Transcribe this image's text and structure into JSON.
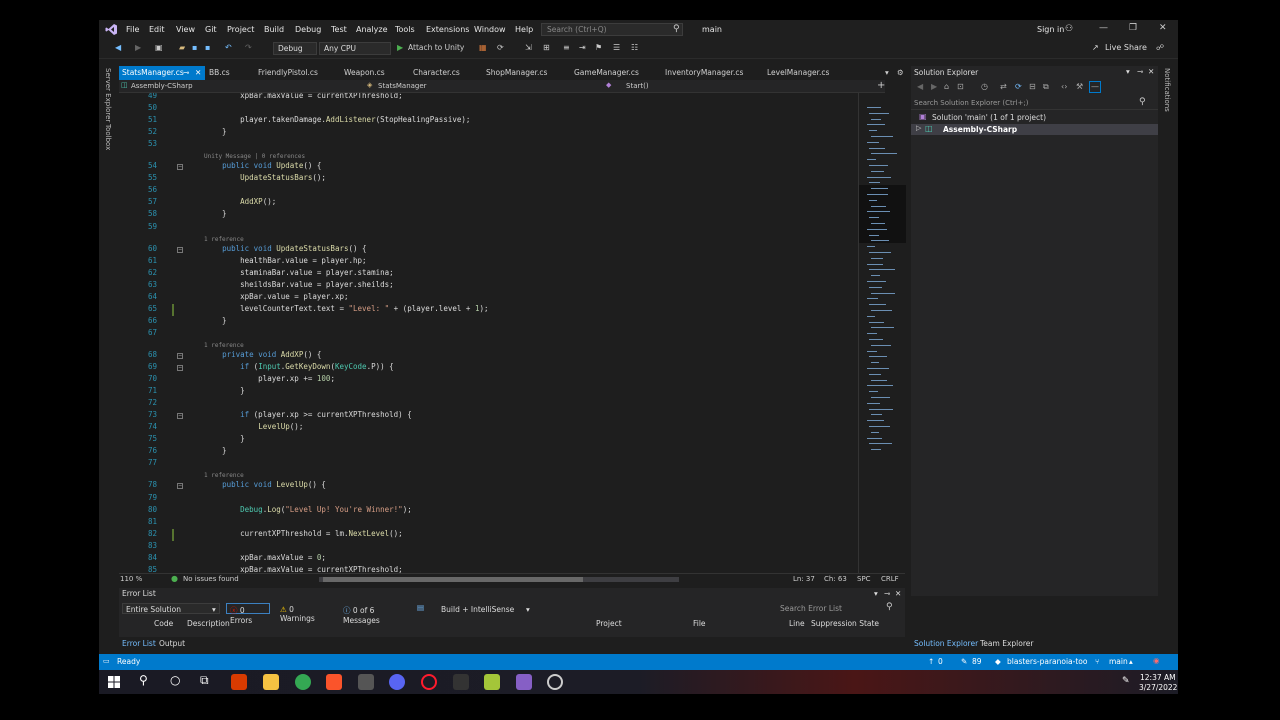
{
  "menu": [
    "File",
    "Edit",
    "View",
    "Git",
    "Project",
    "Build",
    "Debug",
    "Test",
    "Analyze",
    "Tools",
    "Extensions",
    "Window",
    "Help"
  ],
  "search_placeholder": "Search (Ctrl+Q)",
  "branch_title": "main",
  "sign_in": "Sign in",
  "live_share": "Live Share",
  "toolbar": {
    "config": "Debug",
    "platform": "Any CPU",
    "attach": "Attach to Unity"
  },
  "tabs": [
    "StatsManager.cs",
    "BB.cs",
    "FriendlyPistol.cs",
    "Weapon.cs",
    "Character.cs",
    "ShopManager.cs",
    "GameManager.cs",
    "InventoryManager.cs",
    "LevelManager.cs"
  ],
  "navbar": {
    "project": "Assembly-CSharp",
    "class": "StatsManager",
    "member": "Start()"
  },
  "code_lines": [
    {
      "n": "49",
      "t": "        xpBar.maxValue = currentXPThreshold;"
    },
    {
      "n": "50",
      "t": ""
    },
    {
      "n": "51",
      "t": "        player.takenDamage.AddListener(StopHealingPassive);"
    },
    {
      "n": "52",
      "t": "    }"
    },
    {
      "n": "53",
      "t": ""
    },
    {
      "n": "54",
      "t": "    public void Update() {",
      "lens": "Unity Message | 0 references"
    },
    {
      "n": "55",
      "t": "        UpdateStatusBars();"
    },
    {
      "n": "56",
      "t": ""
    },
    {
      "n": "57",
      "t": "        AddXP();"
    },
    {
      "n": "58",
      "t": "    }"
    },
    {
      "n": "59",
      "t": ""
    },
    {
      "n": "60",
      "t": "    public void UpdateStatusBars() {",
      "lens": "1 reference"
    },
    {
      "n": "61",
      "t": "        healthBar.value = player.hp;"
    },
    {
      "n": "62",
      "t": "        staminaBar.value = player.stamina;"
    },
    {
      "n": "63",
      "t": "        sheildsBar.value = player.sheilds;"
    },
    {
      "n": "64",
      "t": "        xpBar.value = player.xp;"
    },
    {
      "n": "65",
      "t": "        levelCounterText.text = \"Level: \" + (player.level + 1);"
    },
    {
      "n": "66",
      "t": "    }"
    },
    {
      "n": "67",
      "t": ""
    },
    {
      "n": "68",
      "t": "    private void AddXP() {",
      "lens": "1 reference"
    },
    {
      "n": "69",
      "t": "        if (Input.GetKeyDown(KeyCode.P)) {"
    },
    {
      "n": "70",
      "t": "            player.xp += 100;"
    },
    {
      "n": "71",
      "t": "        }"
    },
    {
      "n": "72",
      "t": ""
    },
    {
      "n": "73",
      "t": "        if (player.xp >= currentXPThreshold) {"
    },
    {
      "n": "74",
      "t": "            LevelUp();"
    },
    {
      "n": "75",
      "t": "        }"
    },
    {
      "n": "76",
      "t": "    }"
    },
    {
      "n": "77",
      "t": ""
    },
    {
      "n": "78",
      "t": "    public void LevelUp() {",
      "lens": "1 reference"
    },
    {
      "n": "79",
      "t": ""
    },
    {
      "n": "80",
      "t": "        Debug.Log(\"Level Up! You're Winner!\");"
    },
    {
      "n": "81",
      "t": ""
    },
    {
      "n": "82",
      "t": "        currentXPThreshold = lm.NextLevel();"
    },
    {
      "n": "83",
      "t": ""
    },
    {
      "n": "84",
      "t": "        xpBar.maxValue = 0;"
    },
    {
      "n": "85",
      "t": "        xpBar.maxValue = currentXPThreshold;"
    }
  ],
  "editor_status": {
    "zoom": "110 %",
    "issues": "No issues found",
    "ln": "Ln: 37",
    "ch": "Ch: 63",
    "spc": "SPC",
    "eol": "CRLF"
  },
  "solution_explorer": {
    "title": "Solution Explorer",
    "search_placeholder": "Search Solution Explorer (Ctrl+;)",
    "solution": "Solution 'main' (1 of 1 project)",
    "project": "Assembly-CSharp"
  },
  "left_rail": [
    "Server Explorer",
    "Toolbox"
  ],
  "right_rail": [
    "Notifications"
  ],
  "error_list": {
    "title": "Error List",
    "scope": "Entire Solution",
    "errors": "0 Errors",
    "warnings": "0 Warnings",
    "messages": "0 of 6 Messages",
    "build": "Build + IntelliSense",
    "search": "Search Error List",
    "columns": [
      "Code",
      "Description",
      "Project",
      "File",
      "Line",
      "Suppression State"
    ]
  },
  "bottom_tabs": [
    "Error List",
    "Output"
  ],
  "right_bottom_tabs": [
    "Solution Explorer",
    "Team Explorer"
  ],
  "status_bar": {
    "ready": "Ready",
    "up": "0",
    "pencil": "89",
    "repo": "blasters-paranoia-too",
    "branch": "main"
  },
  "clock": {
    "time": "12:37 AM",
    "date": "3/27/2022"
  },
  "colors": {
    "accent": "#007acc",
    "editor_bg": "#1e1e1e",
    "panel_bg": "#252526"
  }
}
